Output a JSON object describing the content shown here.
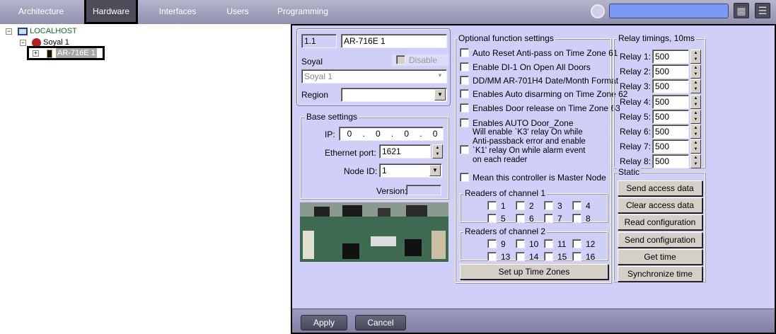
{
  "topbar": {
    "tabs": [
      "Architecture",
      "Hardware",
      "Interfaces",
      "Users",
      "Programming"
    ],
    "active_tab": "Hardware",
    "search_value": ""
  },
  "tree": {
    "root": "LOCALHOST",
    "child": "Soyal 1",
    "selected": "AR-716E 1"
  },
  "device": {
    "number": "1.1",
    "name": "AR-716E 1",
    "type_label": "Soyal",
    "disable_label": "Disable",
    "parent_value": "Soyal 1",
    "region_label": "Region",
    "region_value": ""
  },
  "base": {
    "title": "Base settings",
    "ip_label": "IP:",
    "ip": [
      "0",
      "0",
      "0",
      "0"
    ],
    "port_label": "Ethernet port:",
    "port": "1621",
    "node_label": "Node ID:",
    "node": "1",
    "version_label": "Version:",
    "version": ""
  },
  "optional": {
    "title": "Optional function settings",
    "options": [
      "Auto Reset Anti-pass on Time Zone 61",
      "Enable DI-1 On Open All Doors",
      "DD/MM AR-701H4 Date/Month Format",
      "Enables Auto disarming on Time Zone 62",
      "Enables Door release on Time Zone 63",
      "Enables AUTO Door_Zone",
      "Will enable `K3' relay On while Anti-passback error and enable `K1' relay On while alarm event on each reader",
      "Mean this controller is Master Node"
    ],
    "ch1_title": "Readers of channel 1",
    "ch1": [
      "1",
      "2",
      "3",
      "4",
      "5",
      "6",
      "7",
      "8"
    ],
    "ch2_title": "Readers of channel 2",
    "ch2": [
      "9",
      "10",
      "11",
      "12",
      "13",
      "14",
      "15",
      "16"
    ],
    "timezones_button": "Set up Time Zones"
  },
  "relays": {
    "title": "Relay timings, 10ms",
    "items": [
      {
        "label": "Relay 1:",
        "value": "500"
      },
      {
        "label": "Relay 2:",
        "value": "500"
      },
      {
        "label": "Relay 3:",
        "value": "500"
      },
      {
        "label": "Relay 4:",
        "value": "500"
      },
      {
        "label": "Relay 5:",
        "value": "500"
      },
      {
        "label": "Relay 6:",
        "value": "500"
      },
      {
        "label": "Relay 7:",
        "value": "500"
      },
      {
        "label": "Relay 8:",
        "value": "500"
      }
    ]
  },
  "static": {
    "title": "Static",
    "buttons": [
      "Send access data",
      "Clear access data",
      "Read configuration",
      "Send configuration",
      "Get time",
      "Synchronize time"
    ]
  },
  "footer": {
    "apply": "Apply",
    "cancel": "Cancel"
  }
}
